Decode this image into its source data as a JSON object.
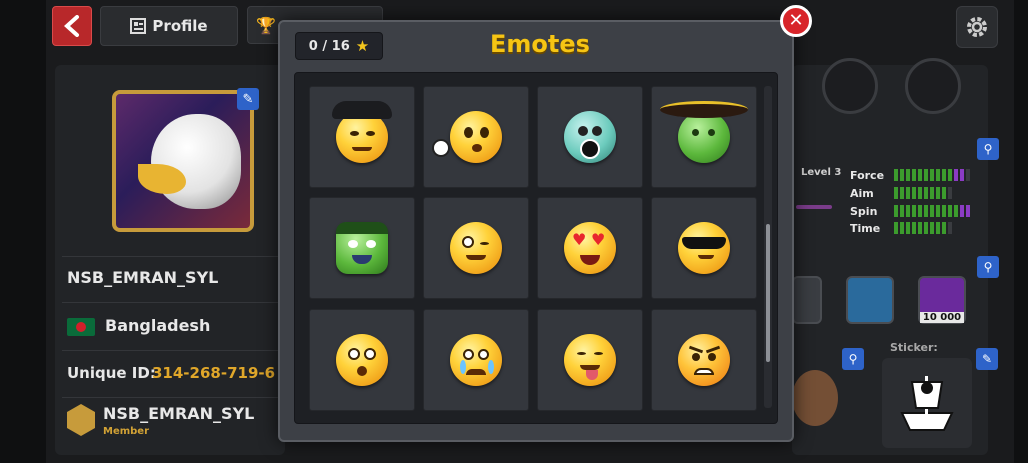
{
  "topbar": {
    "profile_label": "Profile"
  },
  "profile": {
    "username": "NSB_EMRAN_SYL",
    "country": "Bangladesh",
    "unique_id_label": "Unique ID:",
    "unique_id_value": "314-268-719-6",
    "club_name": "NSB_EMRAN_SYL",
    "club_role": "Member"
  },
  "stats": {
    "level_label": "Level 3",
    "items": [
      {
        "label": "Force",
        "value": 0.8
      },
      {
        "label": "Aim",
        "value": 0.7
      },
      {
        "label": "Spin",
        "value": 0.9
      },
      {
        "label": "Time",
        "value": 0.65
      }
    ]
  },
  "right_panel": {
    "sticker_label": "Sticker:",
    "achievement_value": "10 000"
  },
  "modal": {
    "title": "Emotes",
    "counter": "0 / 16",
    "emotes": [
      {
        "name": "gangster-emote"
      },
      {
        "name": "soccer-emote"
      },
      {
        "name": "helmet-emote"
      },
      {
        "name": "mariachi-emote"
      },
      {
        "name": "monster-emote"
      },
      {
        "name": "wink-emote"
      },
      {
        "name": "heart-eyes-emote"
      },
      {
        "name": "sunglasses-emote"
      },
      {
        "name": "surprised-emote"
      },
      {
        "name": "crying-emote"
      },
      {
        "name": "yum-emote"
      },
      {
        "name": "angry-emote"
      }
    ]
  },
  "colors": {
    "title_yellow": "#f6c514",
    "close_red": "#d8252a",
    "accent_blue": "#2e63c9",
    "id_gold": "#e0a72a"
  }
}
